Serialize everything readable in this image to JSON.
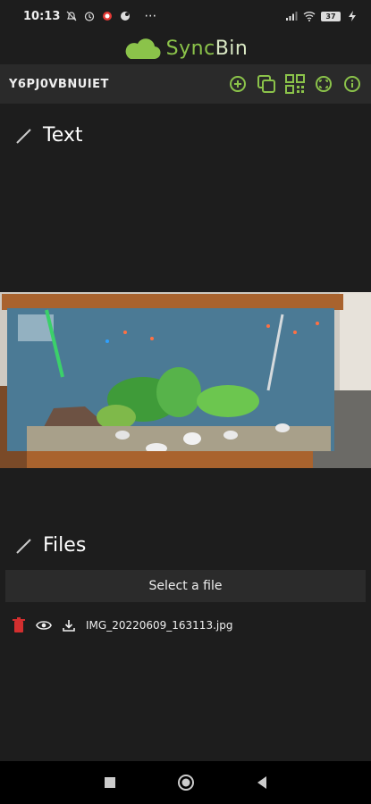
{
  "status_bar": {
    "time": "10:13",
    "battery": "37",
    "icons": [
      "bell-off-icon",
      "alarm-icon",
      "record-icon",
      "notification-icon",
      "more-icon",
      "signal-icon",
      "wifi-icon",
      "battery-icon",
      "charging-icon"
    ]
  },
  "brand": {
    "name_part1": "Sync",
    "name_part2": "Bin",
    "accent": "#8bc34a"
  },
  "toolbar": {
    "bin_id": "Y6PJ0VBNUIET",
    "icons": [
      "add-icon",
      "copy-icon",
      "qr-code-icon",
      "fullscreen-icon",
      "info-icon"
    ]
  },
  "text_section": {
    "title": "Text"
  },
  "files_section": {
    "title": "Files",
    "select_label": "Select a file",
    "files": [
      {
        "name": "IMG_20220609_163113.jpg"
      }
    ]
  },
  "nav": {
    "icons": [
      "recents-icon",
      "home-icon",
      "back-icon"
    ]
  }
}
